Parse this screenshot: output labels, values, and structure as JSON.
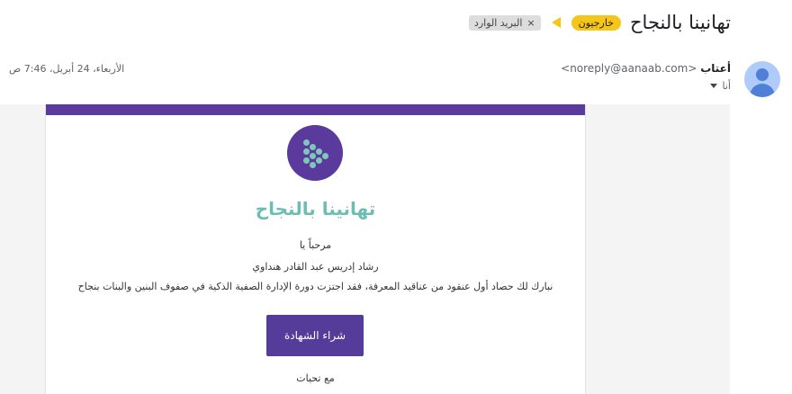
{
  "header": {
    "subject": "تهانينا بالنجاح",
    "labels": {
      "external": "خارجيون",
      "inbox": "البريد الوارد",
      "inbox_remove": "×"
    }
  },
  "message": {
    "sender_name": "أعتاب",
    "sender_email": "<noreply@aanaab.com>",
    "recipient": "أنا",
    "datetime": "الأربعاء، 24 أبريل، 7:46 ص"
  },
  "email": {
    "headline": "تهانينا بالنجاح",
    "greeting": "مرحباً يا",
    "name": "رشاد إدريس عبد القادر هنداوي",
    "message": "نبارك لك حصاد أول عنقود من عناقيد المعرفة، فقد اجتزت دورة الإدارة الصفية الذكية في صفوف البنين والبنات بنجاح",
    "button_label": "شراء الشهادة",
    "signoff": "مع تحيات"
  },
  "colors": {
    "brand_purple": "#5a3a9c",
    "headline_teal": "#6cbeb4",
    "external_label": "#f5c518",
    "avatar_bg": "#aecbfa"
  },
  "icons": {
    "importance": "importance-marker-icon",
    "avatar": "avatar-icon",
    "logo": "aanaab-logo",
    "expand": "caret-down-icon"
  }
}
